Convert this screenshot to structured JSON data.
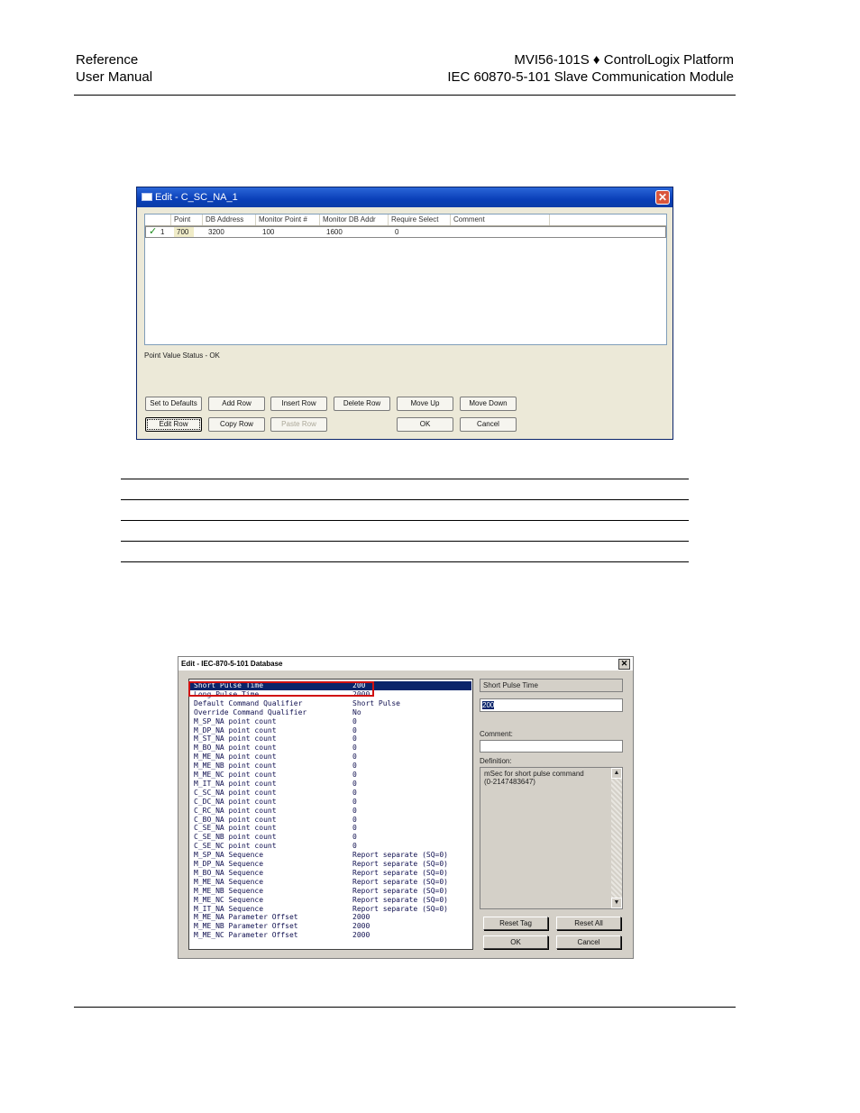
{
  "header": {
    "left_line1": "Reference",
    "left_line2": "User Manual",
    "right_line1": "MVI56-101S ♦ ControlLogix Platform",
    "right_line2": "IEC 60870-5-101 Slave Communication Module"
  },
  "dialog1": {
    "title": "Edit - C_SC_NA_1",
    "columns": [
      "Point",
      "DB Address",
      "Monitor Point #",
      "Monitor DB Addr",
      "Require Select",
      "Comment"
    ],
    "row": {
      "index": "1",
      "check": "✓",
      "point": "700",
      "db_address": "3200",
      "monitor_point": "100",
      "monitor_db_addr": "1600",
      "require_select": "0",
      "comment": ""
    },
    "status": "Point Value Status - OK",
    "buttons": {
      "set_defaults": "Set to Defaults",
      "add_row": "Add Row",
      "insert_row": "Insert Row",
      "delete_row": "Delete Row",
      "move_up": "Move Up",
      "move_down": "Move Down",
      "edit_row": "Edit Row",
      "copy_row": "Copy Row",
      "paste_row": "Paste Row",
      "ok": "OK",
      "cancel": "Cancel"
    }
  },
  "dialog2": {
    "title": "Edit - IEC-870-5-101 Database",
    "items": [
      {
        "key": "Short Pulse Time",
        "value": "200"
      },
      {
        "key": "Long Pulse Time",
        "value": "2000"
      },
      {
        "key": "Default Command Qualifier",
        "value": "Short Pulse"
      },
      {
        "key": "Override Command Qualifier",
        "value": "No"
      },
      {
        "key": "M_SP_NA point count",
        "value": "0"
      },
      {
        "key": "M_DP_NA point count",
        "value": "0"
      },
      {
        "key": "M_ST_NA point count",
        "value": "0"
      },
      {
        "key": "M_BO_NA point count",
        "value": "0"
      },
      {
        "key": "M_ME_NA point count",
        "value": "0"
      },
      {
        "key": "M_ME_NB point count",
        "value": "0"
      },
      {
        "key": "M_ME_NC point count",
        "value": "0"
      },
      {
        "key": "M_IT_NA point count",
        "value": "0"
      },
      {
        "key": "C_SC_NA point count",
        "value": "0"
      },
      {
        "key": "C_DC_NA point count",
        "value": "0"
      },
      {
        "key": "C_RC_NA point count",
        "value": "0"
      },
      {
        "key": "C_BO_NA point count",
        "value": "0"
      },
      {
        "key": "C_SE_NA point count",
        "value": "0"
      },
      {
        "key": "C_SE_NB point count",
        "value": "0"
      },
      {
        "key": "C_SE_NC point count",
        "value": "0"
      },
      {
        "key": "M_SP_NA Sequence",
        "value": "Report separate (SQ=0)"
      },
      {
        "key": "M_DP_NA Sequence",
        "value": "Report separate (SQ=0)"
      },
      {
        "key": "M_BO_NA Sequence",
        "value": "Report separate (SQ=0)"
      },
      {
        "key": "M_ME_NA Sequence",
        "value": "Report separate (SQ=0)"
      },
      {
        "key": "M_ME_NB Sequence",
        "value": "Report separate (SQ=0)"
      },
      {
        "key": "M_ME_NC Sequence",
        "value": "Report separate (SQ=0)"
      },
      {
        "key": "M_IT_NA Sequence",
        "value": "Report separate (SQ=0)"
      },
      {
        "key": "M_ME_NA Parameter Offset",
        "value": "2000"
      },
      {
        "key": "M_ME_NB Parameter Offset",
        "value": "2000"
      },
      {
        "key": "M_ME_NC Parameter Offset",
        "value": "2000"
      }
    ],
    "selected_name": "Short Pulse Time",
    "value_input": "200",
    "comment_label": "Comment:",
    "comment_value": "",
    "definition_label": "Definition:",
    "definition_text_1": "mSec for short pulse command",
    "definition_text_2": "(0-2147483647)",
    "buttons": {
      "reset_tag": "Reset Tag",
      "reset_all": "Reset All",
      "ok": "OK",
      "cancel": "Cancel"
    }
  }
}
